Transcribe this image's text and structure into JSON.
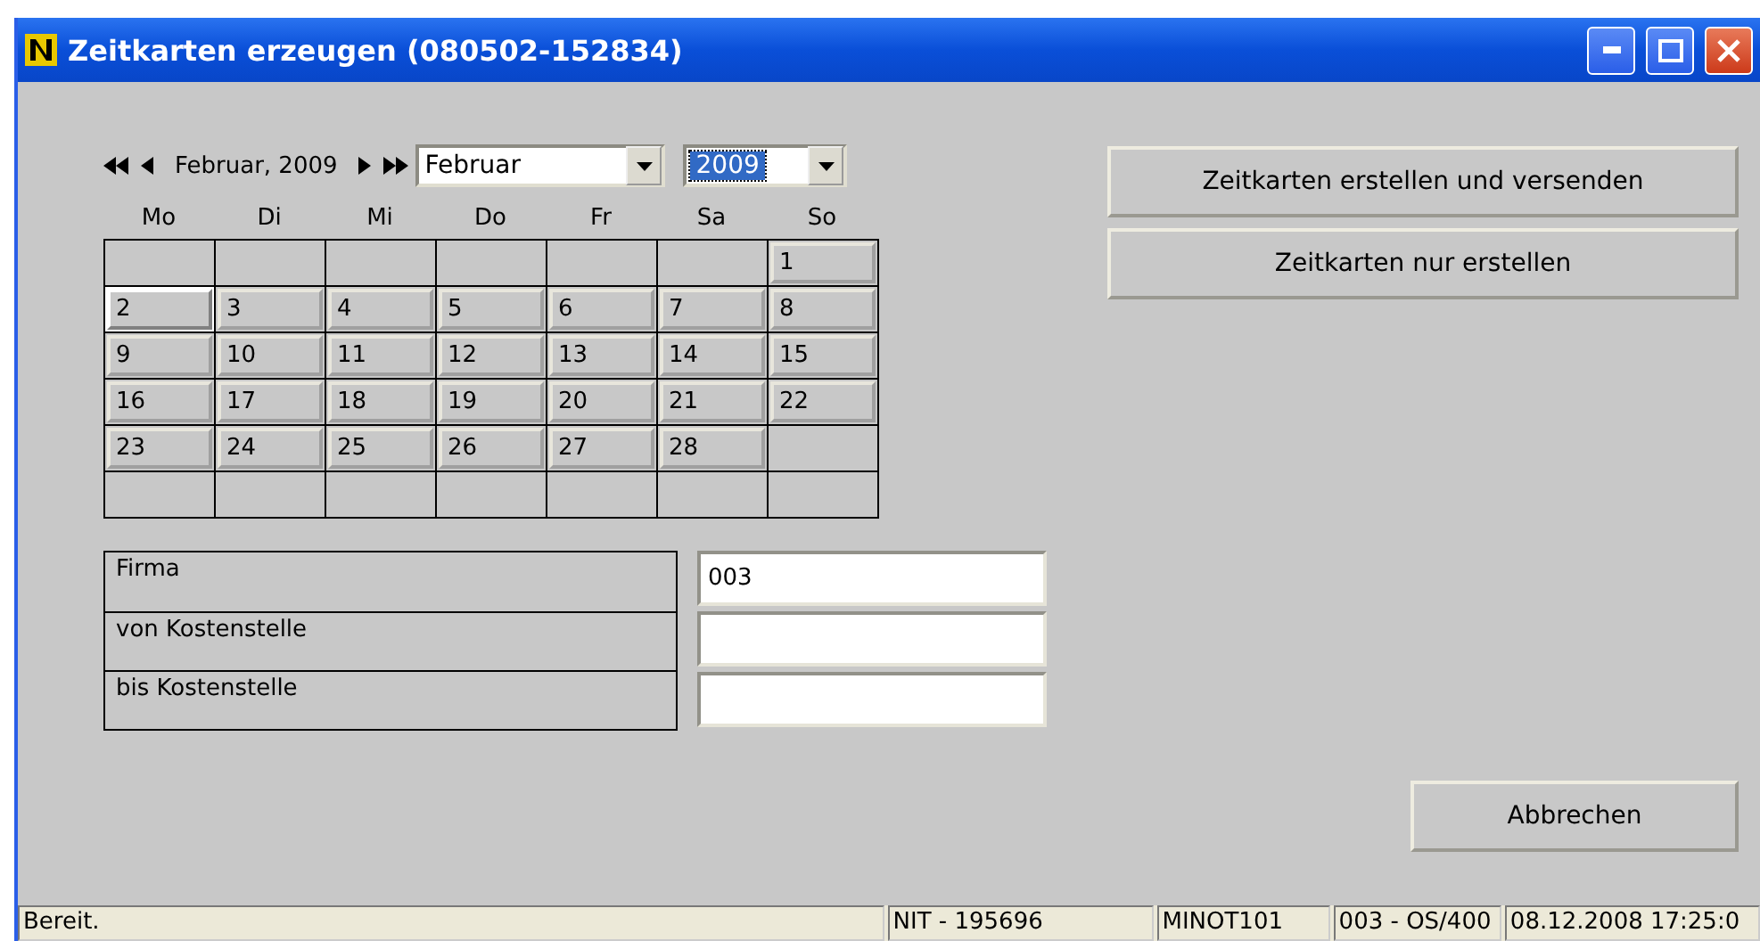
{
  "window": {
    "title": "Zeitkarten erzeugen (080502-152834)"
  },
  "calendar": {
    "caption": "Februar, 2009",
    "month_select": {
      "value": "Februar",
      "focused": false
    },
    "year_select": {
      "value": "2009",
      "focused": true
    },
    "weekdays": [
      "Mo",
      "Di",
      "Mi",
      "Do",
      "Fr",
      "Sa",
      "So"
    ],
    "weeks": [
      [
        {
          "kind": "blank"
        },
        {
          "kind": "blank"
        },
        {
          "kind": "blank"
        },
        {
          "kind": "blank"
        },
        {
          "kind": "blank"
        },
        {
          "kind": "blank"
        },
        {
          "kind": "day",
          "day": "1",
          "selected": false
        }
      ],
      [
        {
          "day": "2",
          "selected": true
        },
        {
          "day": "3",
          "selected": false
        },
        {
          "day": "4",
          "selected": false
        },
        {
          "day": "5",
          "selected": false
        },
        {
          "day": "6",
          "selected": false
        },
        {
          "day": "7",
          "selected": false
        },
        {
          "day": "8",
          "selected": false
        }
      ],
      [
        {
          "day": "9",
          "selected": false
        },
        {
          "day": "10",
          "selected": false
        },
        {
          "day": "11",
          "selected": false
        },
        {
          "day": "12",
          "selected": false
        },
        {
          "day": "13",
          "selected": false
        },
        {
          "day": "14",
          "selected": false
        },
        {
          "day": "15",
          "selected": false
        }
      ],
      [
        {
          "day": "16",
          "selected": false
        },
        {
          "day": "17",
          "selected": false
        },
        {
          "day": "18",
          "selected": false
        },
        {
          "day": "19",
          "selected": false
        },
        {
          "day": "20",
          "selected": false
        },
        {
          "day": "21",
          "selected": false
        },
        {
          "day": "22",
          "selected": false
        }
      ],
      [
        {
          "day": "23",
          "selected": false
        },
        {
          "day": "24",
          "selected": false
        },
        {
          "day": "25",
          "selected": false
        },
        {
          "day": "26",
          "selected": false
        },
        {
          "day": "27",
          "selected": false
        },
        {
          "day": "28",
          "selected": false
        },
        {
          "kind": "blank"
        }
      ],
      [
        {
          "kind": "blank"
        },
        {
          "kind": "blank"
        },
        {
          "kind": "blank"
        },
        {
          "kind": "blank"
        },
        {
          "kind": "blank"
        },
        {
          "kind": "blank"
        },
        {
          "kind": "blank"
        }
      ]
    ]
  },
  "fields": [
    {
      "label": "Firma",
      "value": "003"
    },
    {
      "label": "von Kostenstelle"
    },
    {
      "label": "bis Kostenstelle"
    }
  ],
  "actions": [
    "Zeitkarten erstellen und versenden",
    "Zeitkarten nur erstellen"
  ],
  "cancel_button": "Abbrechen",
  "status_bar": [
    "Bereit.",
    "NIT - 195696",
    "MINOT101",
    "003 - OS/400",
    "08.12.2008 17:25:0"
  ]
}
